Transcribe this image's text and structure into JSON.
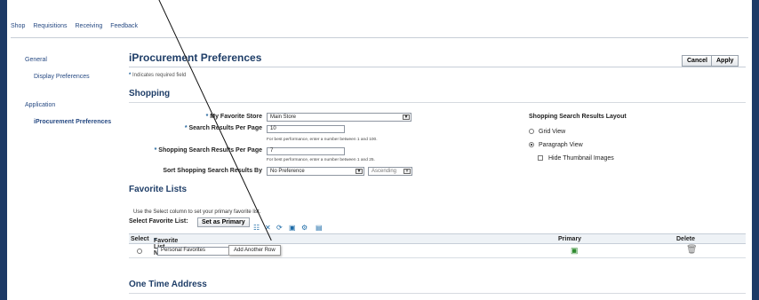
{
  "nav": [
    "Shop",
    "Requisitions",
    "Receiving",
    "Feedback"
  ],
  "sidebar": {
    "general": "General",
    "display": "Display Preferences",
    "application": "Application",
    "iprocurement": "iProcurement Preferences"
  },
  "page": {
    "title": "iProcurement Preferences",
    "required": "Indicates required field",
    "cancel": "Cancel",
    "apply": "Apply"
  },
  "shopping": {
    "title": "Shopping",
    "favorite_store_label": "My Favorite Store",
    "favorite_store_value": "Main Store",
    "search_per_page_label": "Search Results Per Page",
    "search_per_page_value": "10",
    "search_hint": "For best performance, enter a number between 1 and 100.",
    "shopping_per_page_label": "Shopping Search Results Per Page",
    "shopping_per_page_value": "7",
    "shopping_hint": "For best performance, enter a number between 1 and 25.",
    "sort_label": "Sort Shopping Search Results By",
    "sort_value": "No Preference",
    "order_value": "Ascending",
    "layout_title": "Shopping Search Results Layout",
    "grid": "Grid View",
    "paragraph": "Paragraph View",
    "hide": "Hide Thumbnail Images"
  },
  "favorites": {
    "title": "Favorite Lists",
    "tooltip": "Add Another Row",
    "instruction": "Use the Select column to set your primary favorite list.",
    "select_label": "Select Favorite List:",
    "set_primary": "Set as Primary",
    "cols": [
      "Select",
      "Favorite List Name",
      "Primary",
      "Delete"
    ],
    "row_name": "Personal Favorites"
  },
  "address": {
    "title": "One Time Address"
  }
}
